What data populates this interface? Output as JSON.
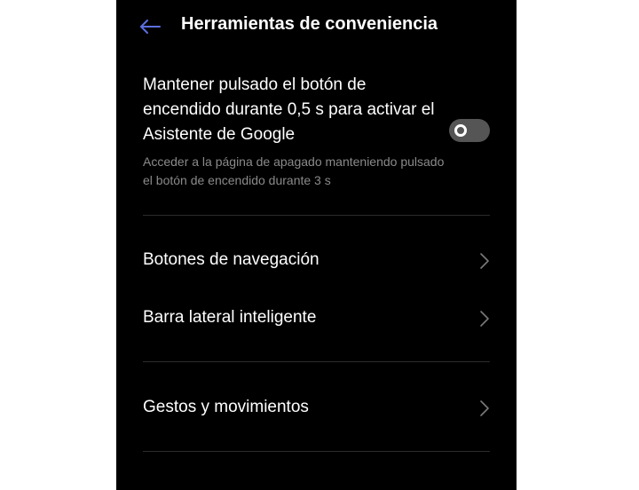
{
  "header": {
    "back_icon": "arrow-left-icon",
    "title": "Herramientas de conveniencia",
    "accent_color": "#5b6fe0"
  },
  "assistant_setting": {
    "title": "Mantener pulsado el botón de encendido durante 0,5 s para activar el Asistente de Google",
    "description": "Acceder a la página de apagado manteniendo pulsado el botón de encendido durante 3 s",
    "toggle_state": "off"
  },
  "menu": {
    "items": [
      {
        "label": "Botones de navegación",
        "icon": "chevron-right-icon"
      },
      {
        "label": "Barra lateral inteligente",
        "icon": "chevron-right-icon"
      },
      {
        "label": "Gestos y movimientos",
        "icon": "chevron-right-icon"
      }
    ]
  },
  "colors": {
    "background": "#000000",
    "text_primary": "#ffffff",
    "text_secondary": "#8a8a8a",
    "toggle_off": "#555555",
    "divider": "#2c2c2c"
  }
}
